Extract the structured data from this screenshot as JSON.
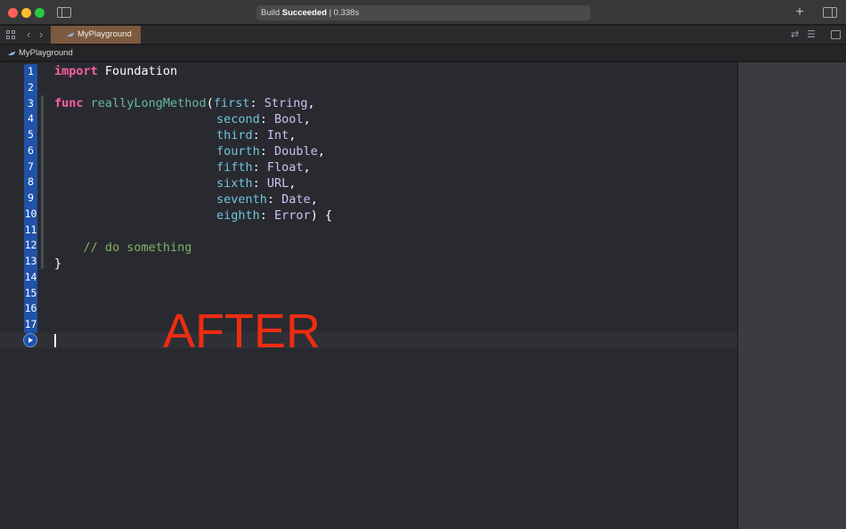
{
  "window": {
    "status_prefix": "Build ",
    "status_bold": "Succeeded",
    "status_suffix": " | 0.338s",
    "plus_label": "+"
  },
  "tabbar": {
    "back_glyph": "‹",
    "forward_glyph": "›",
    "active_tab": "MyPlayground",
    "swap_glyph": "⇄",
    "lines_glyph": "☰"
  },
  "breadcrumb": {
    "label": "MyPlayground"
  },
  "editor": {
    "line_numbers": [
      "1",
      "2",
      "3",
      "4",
      "5",
      "6",
      "7",
      "8",
      "9",
      "10",
      "11",
      "12",
      "13",
      "14",
      "15",
      "16",
      "17"
    ],
    "code": {
      "l1_kw": "import",
      "l1_rest": " Foundation",
      "l3_kw": "func",
      "l3_fn": " reallyLongMethod",
      "l3_open": "(",
      "first_label": "first",
      "first_type": "String",
      "second_label": "second",
      "second_type": "Bool",
      "third_label": "third",
      "third_type": "Int",
      "fourth_label": "fourth",
      "fourth_type": "Double",
      "fifth_label": "fifth",
      "fifth_type": "Float",
      "sixth_label": "sixth",
      "sixth_type": "URL",
      "seventh_label": "seventh",
      "seventh_type": "Date",
      "eighth_label": "eighth",
      "eighth_type": "Error",
      "colon": ": ",
      "comma": ",",
      "close_brace_open": ") {",
      "comment": "    // do something",
      "closing": "}"
    },
    "overlay_label": "AFTER"
  },
  "icons": [
    "close-window-icon",
    "minimize-window-icon",
    "zoom-window-icon",
    "sidebar-toggle-icon",
    "add-icon",
    "inspector-toggle-icon",
    "grid-icon",
    "chevron-left-icon",
    "chevron-right-icon",
    "swift-icon",
    "swap-icon",
    "lines-icon",
    "panel-icon",
    "run-icon"
  ],
  "colors": {
    "keyword": "#fc5fa3",
    "function": "#67b7a4",
    "parameter": "#6fc3df",
    "type": "#d0bff5",
    "comment": "#7fb16a",
    "tab_active": "#7c5a3f",
    "gutter": "#1f52a8",
    "overlay": "#ee2c12"
  }
}
